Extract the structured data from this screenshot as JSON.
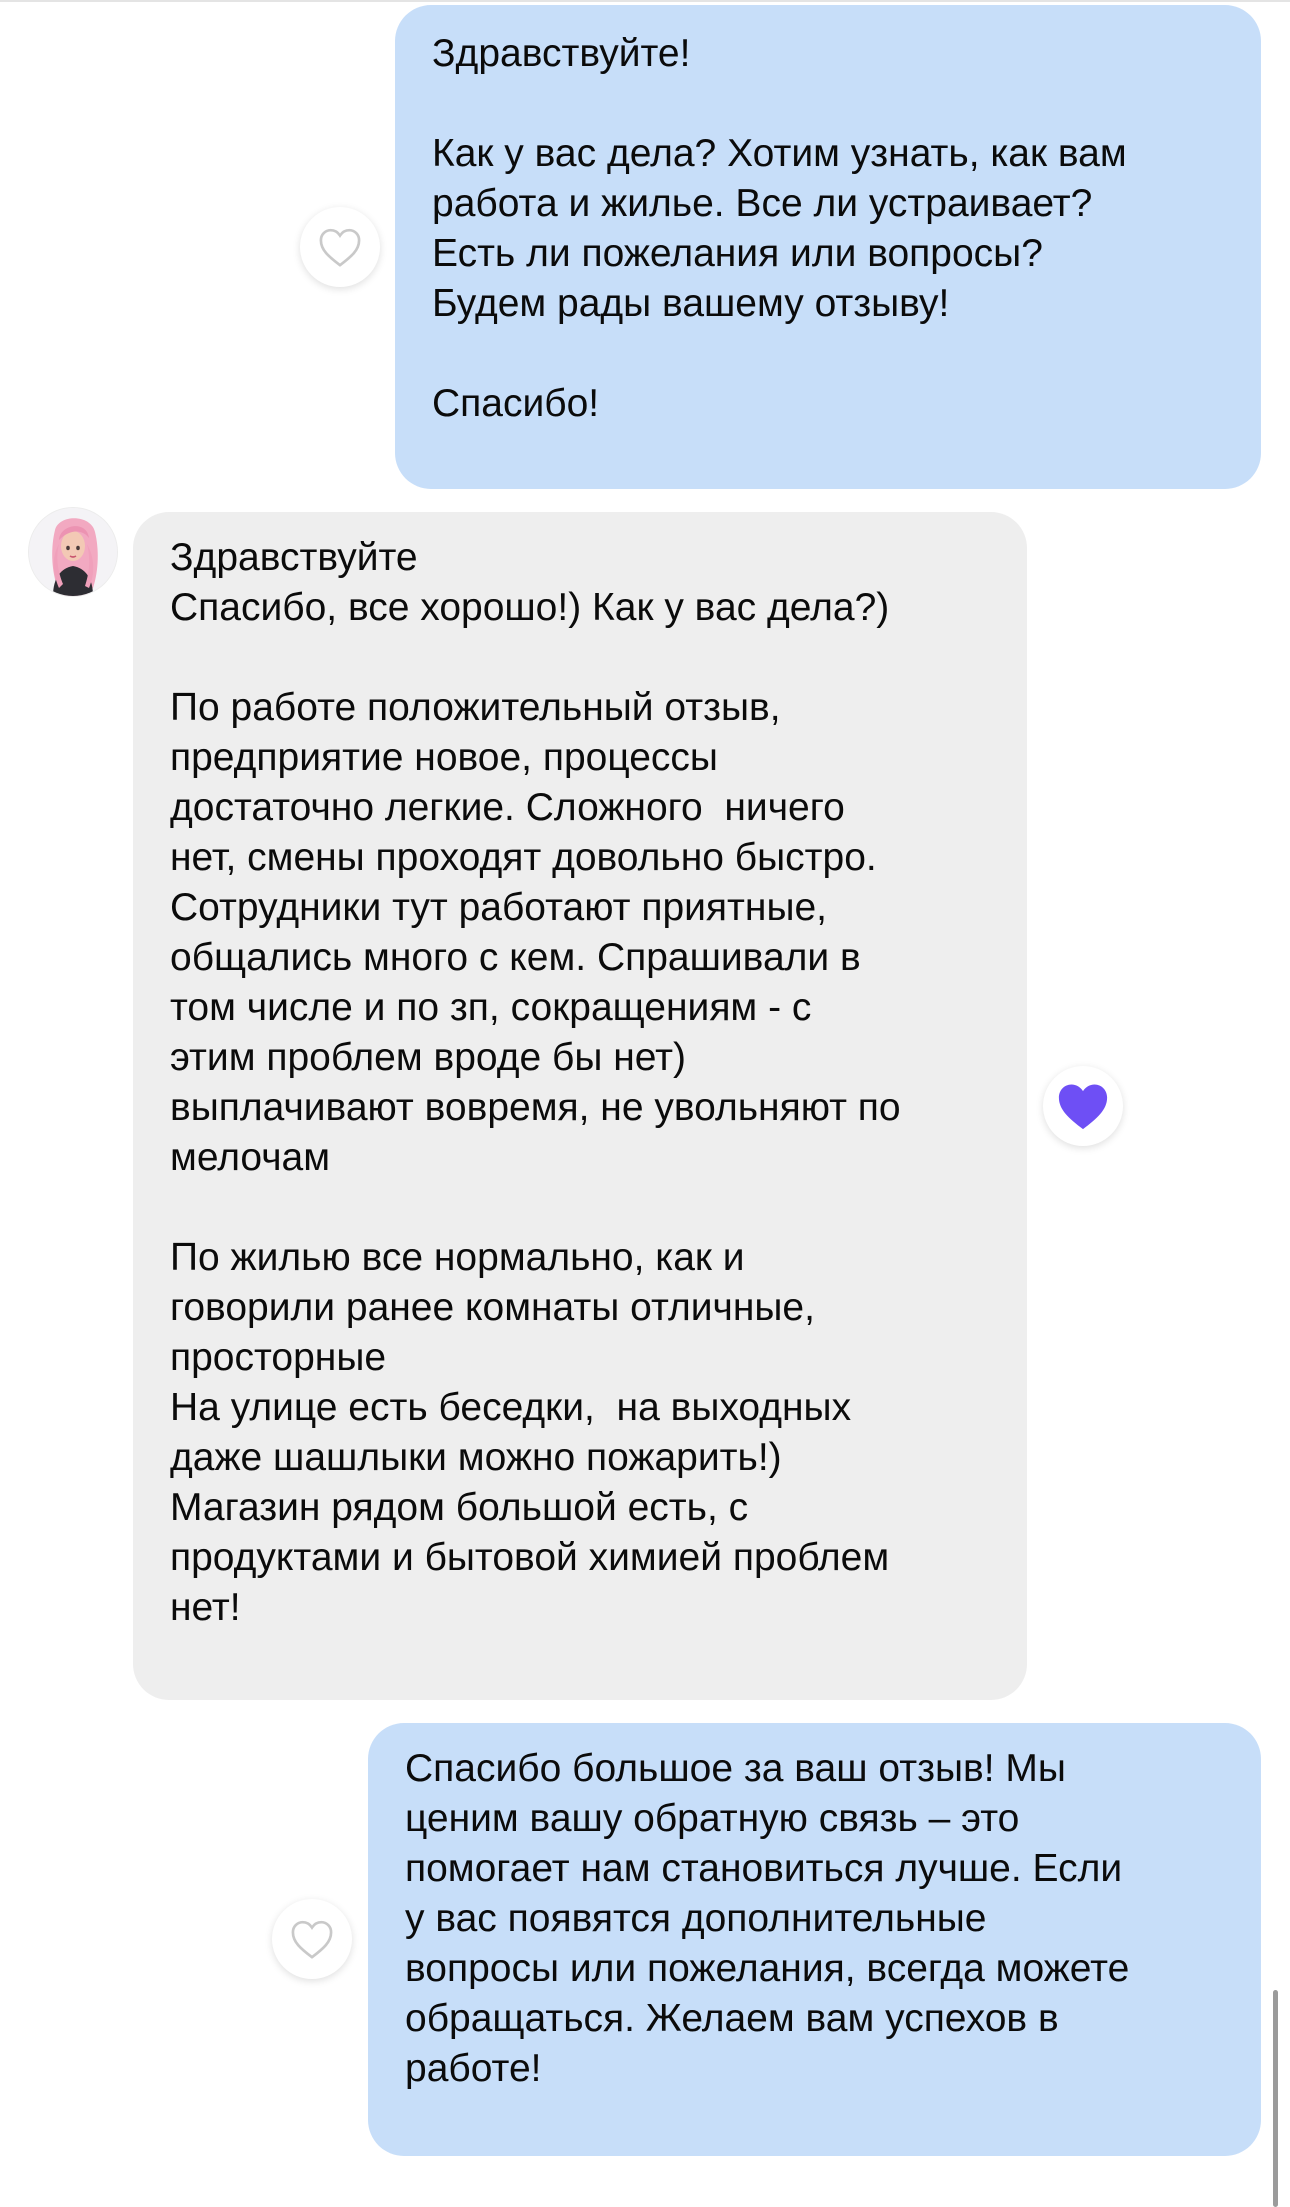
{
  "messages": [
    {
      "direction": "outgoing",
      "text": "Здравствуйте!\n\nКак у вас дела? Хотим узнать, как вам\nработа и жилье. Все ли устраивает?\nЕсть ли пожелания или вопросы?\nБудем рады вашему отзыву!\n\nСпасибо!",
      "liked": false
    },
    {
      "direction": "incoming",
      "text": "Здравствуйте\nСпасибо, все хорошо!) Как у вас дела?)\n\nПо работе положительный отзыв,\nпредприятие новое, процессы\nдостаточно легкие. Сложного  ничего\nнет, смены проходят довольно быстро.\nСотрудники тут работают приятные,\nобщались много с кем. Спрашивали в\nтом числе и по зп, сокращениям - с\nэтим проблем вроде бы нет)\nвыплачивают вовремя, не увольняют по\nмелочам\n\nПо жилью все нормально, как и\nговорили ранее комнаты отличные,\nпросторные\nНа улице есть беседки,  на выходных\nдаже шашлыки можно пожарить!)\nМагазин рядом большой есть, с\nпродуктами и бытовой химией проблем\nнет!",
      "liked": true
    },
    {
      "direction": "outgoing",
      "text": "Спасибо большое за ваш отзыв! Мы\nценим вашу обратную связь – это\nпомогает нам становиться лучше. Если\nу вас появятся дополнительные\nвопросы или пожелания, всегда можете\nобращаться. Желаем вам успехов в\nработе!",
      "liked": false
    }
  ],
  "icons": {
    "like_empty": "heart-outline-icon",
    "like_filled": "heart-filled-icon",
    "avatar": "user-avatar"
  },
  "colors": {
    "outgoing_bubble": "#c7def9",
    "incoming_bubble": "#eeeeee",
    "heart_outline": "#c9c9c9",
    "heart_filled": "#6e4ff5"
  }
}
